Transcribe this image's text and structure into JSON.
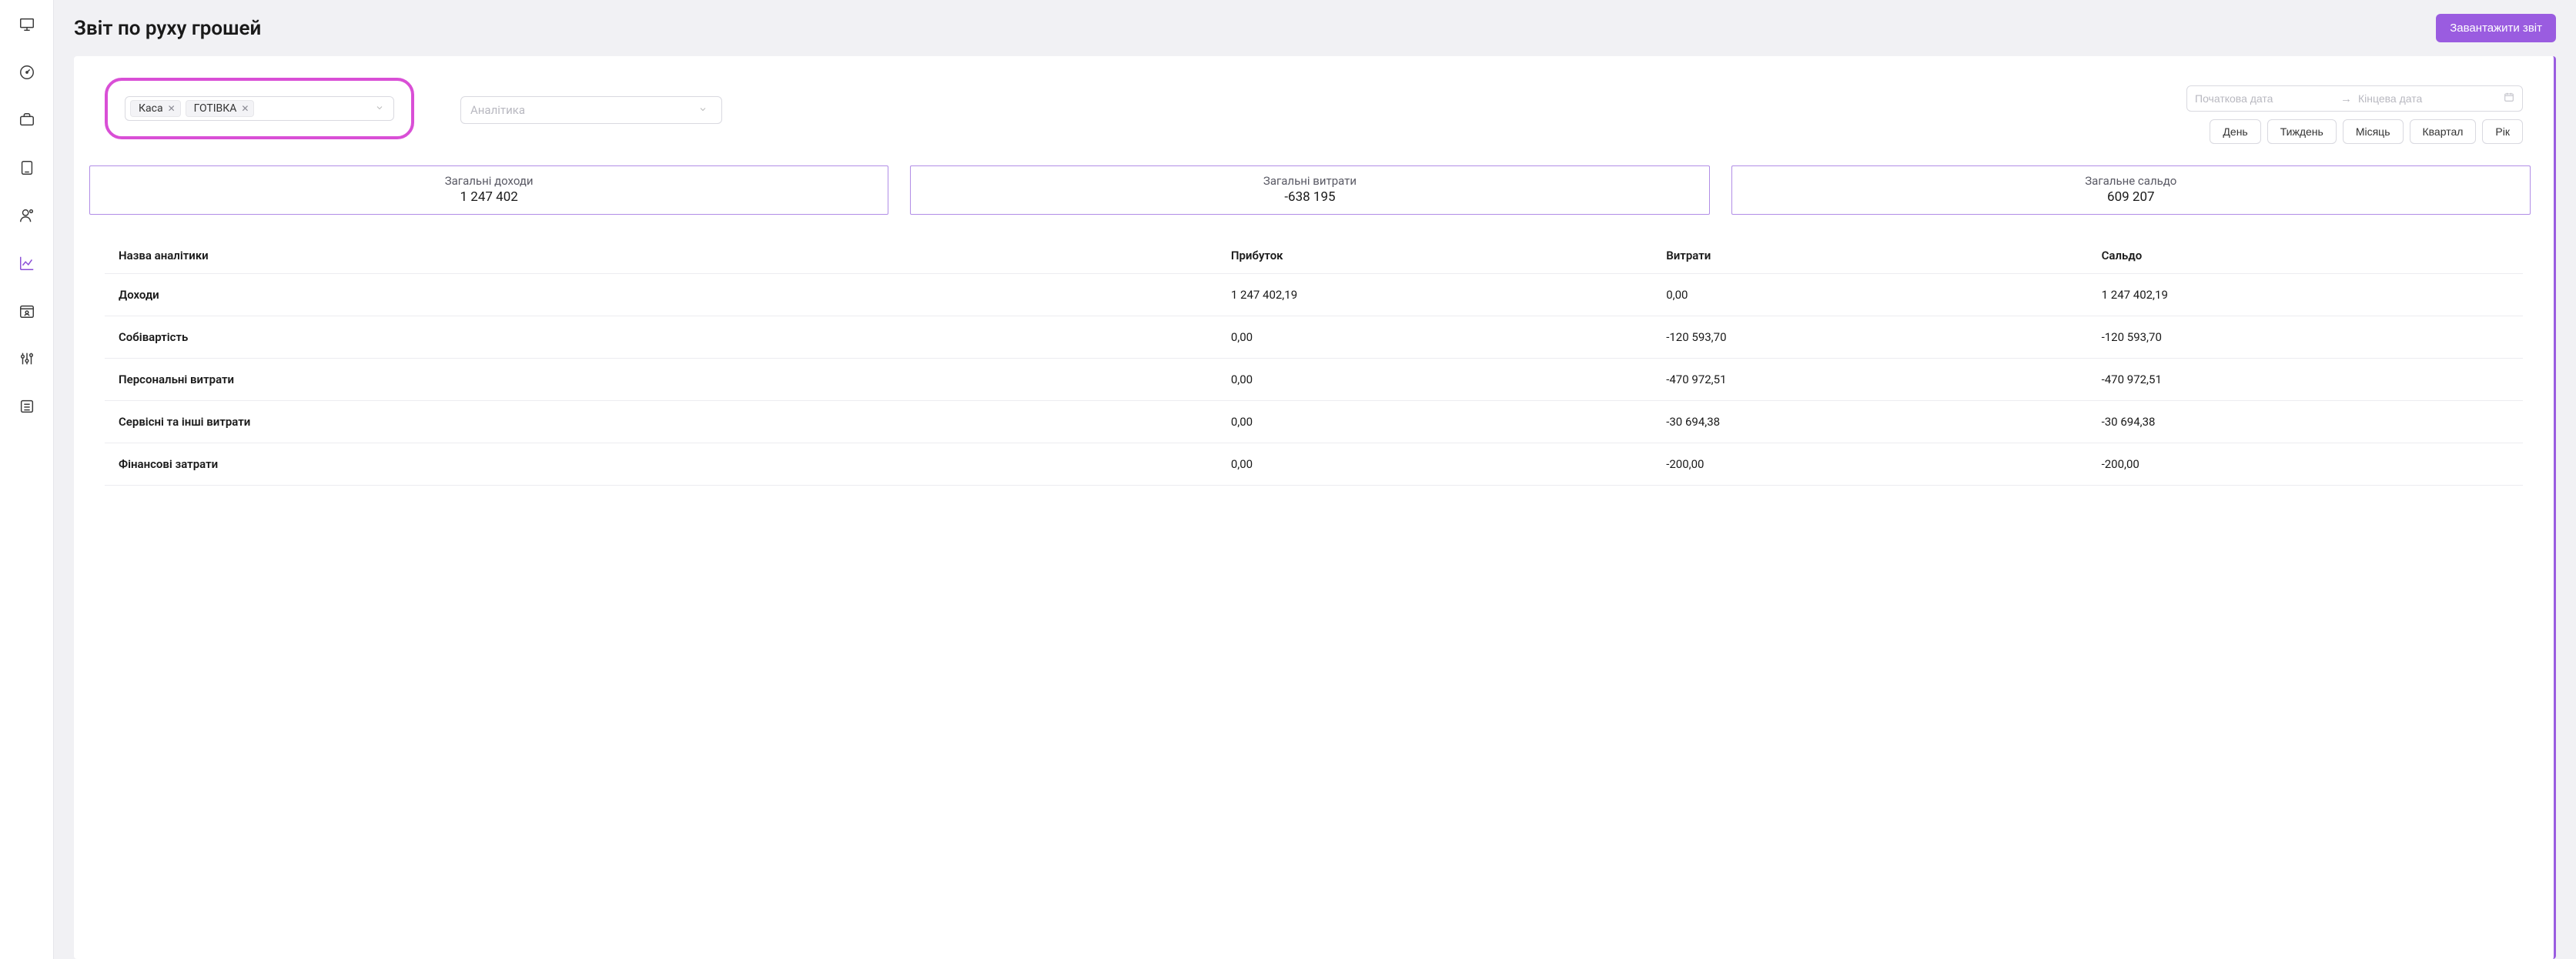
{
  "header": {
    "title": "Звіт по руху грошей",
    "download_label": "Завантажити звіт"
  },
  "sidebar": {
    "items": [
      {
        "name": "monitor-icon"
      },
      {
        "name": "gauge-icon"
      },
      {
        "name": "briefcase-icon"
      },
      {
        "name": "tablet-icon"
      },
      {
        "name": "user-icon"
      },
      {
        "name": "chart-icon"
      },
      {
        "name": "calendar-user-icon"
      },
      {
        "name": "sliders-icon"
      },
      {
        "name": "list-icon"
      }
    ],
    "active_index": 5
  },
  "filters": {
    "cash_select": {
      "tags": [
        "Каса",
        "ГОТІВКА"
      ]
    },
    "analytics_placeholder": "Аналітика",
    "date_start_placeholder": "Початкова дата",
    "date_end_placeholder": "Кінцева дата",
    "periods": [
      "День",
      "Тиждень",
      "Місяць",
      "Квартал",
      "Рік"
    ]
  },
  "summary": {
    "income": {
      "label": "Загальні доходи",
      "value": "1 247 402"
    },
    "expense": {
      "label": "Загальні витрати",
      "value": "-638 195"
    },
    "balance": {
      "label": "Загальне сальдо",
      "value": "609 207"
    }
  },
  "table": {
    "columns": {
      "name": "Назва аналітики",
      "profit": "Прибуток",
      "expense": "Витрати",
      "balance": "Сальдо"
    },
    "rows": [
      {
        "name": "Доходи",
        "profit": "1 247 402,19",
        "expense": "0,00",
        "balance": "1 247 402,19"
      },
      {
        "name": "Собівартість",
        "profit": "0,00",
        "expense": "-120 593,70",
        "balance": "-120 593,70"
      },
      {
        "name": "Персональні витрати",
        "profit": "0,00",
        "expense": "-470 972,51",
        "balance": "-470 972,51"
      },
      {
        "name": "Сервісні та інші витрати",
        "profit": "0,00",
        "expense": "-30 694,38",
        "balance": "-30 694,38"
      },
      {
        "name": "Фінансові затрати",
        "profit": "0,00",
        "expense": "-200,00",
        "balance": "-200,00"
      }
    ]
  }
}
